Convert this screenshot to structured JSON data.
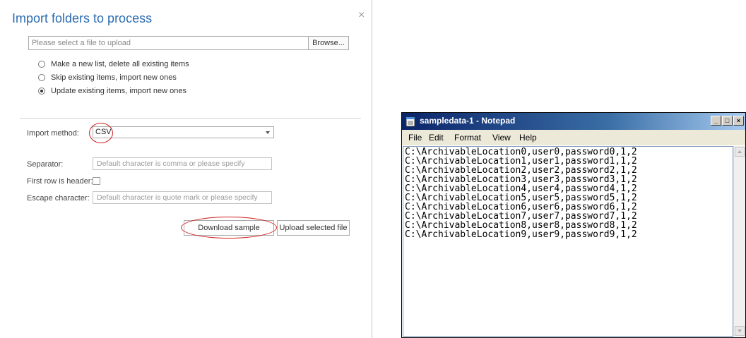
{
  "dialog": {
    "title": "Import folders to process",
    "close_glyph": "×",
    "file_placeholder": "Please select a file to upload",
    "browse_label": "Browse...",
    "options": [
      {
        "label": "Make a new list, delete all existing items",
        "checked": false
      },
      {
        "label": "Skip existing items, import new ones",
        "checked": false
      },
      {
        "label": "Update existing items, import new ones",
        "checked": true
      }
    ],
    "import_method_label": "Import method:",
    "import_method_value": "CSV",
    "separator_label": "Separator:",
    "separator_placeholder": "Default character is comma or please specify",
    "first_row_label": "First row is header:",
    "escape_label": "Escape character:",
    "escape_placeholder": "Default character is quote mark or please specify",
    "download_label": "Download sample",
    "upload_label": "Upload selected file",
    "highlight_color": "#d0201f",
    "title_color": "#2b6cb0"
  },
  "notepad": {
    "title": "sampledata-1 - Notepad",
    "menu": [
      "File",
      "Edit",
      "Format",
      "View",
      "Help"
    ],
    "window_buttons": [
      "_",
      "□",
      "×"
    ],
    "lines": [
      "C:\\ArchivableLocation0,user0,password0,1,2",
      "C:\\ArchivableLocation1,user1,password1,1,2",
      "C:\\ArchivableLocation2,user2,password2,1,2",
      "C:\\ArchivableLocation3,user3,password3,1,2",
      "C:\\ArchivableLocation4,user4,password4,1,2",
      "C:\\ArchivableLocation5,user5,password5,1,2",
      "C:\\ArchivableLocation6,user6,password6,1,2",
      "C:\\ArchivableLocation7,user7,password7,1,2",
      "C:\\ArchivableLocation8,user8,password8,1,2",
      "C:\\ArchivableLocation9,user9,password9,1,2"
    ],
    "icon": "notepad-icon"
  }
}
